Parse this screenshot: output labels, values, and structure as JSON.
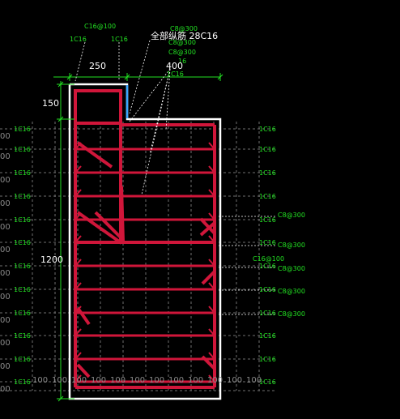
{
  "top_labels": {
    "left_rebar": "1C16",
    "mid_rebar": "1C16",
    "stirrup": "C16@100",
    "all_long": "全部纵筋 28C16",
    "s1": "C8@300",
    "s2": "C8@300",
    "s3": "C8@300",
    "small_16": "16",
    "one_c16": "1C16"
  },
  "dims": {
    "width_left": "250",
    "width_right": "400",
    "flange_height": "150",
    "total_height": "1200"
  },
  "row_labels_left": [
    "1C16",
    "1C16",
    "1C16",
    "1C16",
    "1C16",
    "1C16",
    "1C16",
    "1C16",
    "1C16",
    "1C16",
    "1C16",
    "1C16"
  ],
  "row_labels_right": [
    "1C16",
    "1C16",
    "1C16",
    "1C16",
    "1C16",
    "1C16",
    "1C16",
    "1C16",
    "1C16",
    "1C16",
    "1C16",
    "1C16"
  ],
  "right_stirrups": [
    "C8@300",
    "C8@300",
    "C16@100",
    "C8@300",
    "C8@300",
    "C8@300"
  ],
  "left_gray": [
    "00",
    "00",
    "00",
    "00",
    "00",
    "00",
    "00",
    "00",
    "00",
    "00",
    "00",
    "00"
  ],
  "bottom_gray": [
    "100",
    "100",
    "100",
    "100",
    "100",
    "100",
    "100",
    "100",
    "100",
    "100",
    "100",
    "100"
  ],
  "colors": {
    "rebar": "#d0163a",
    "outline": "#ffffff",
    "dim": "#22e022",
    "cut": "#3aa6ff",
    "grid": "#707070"
  }
}
